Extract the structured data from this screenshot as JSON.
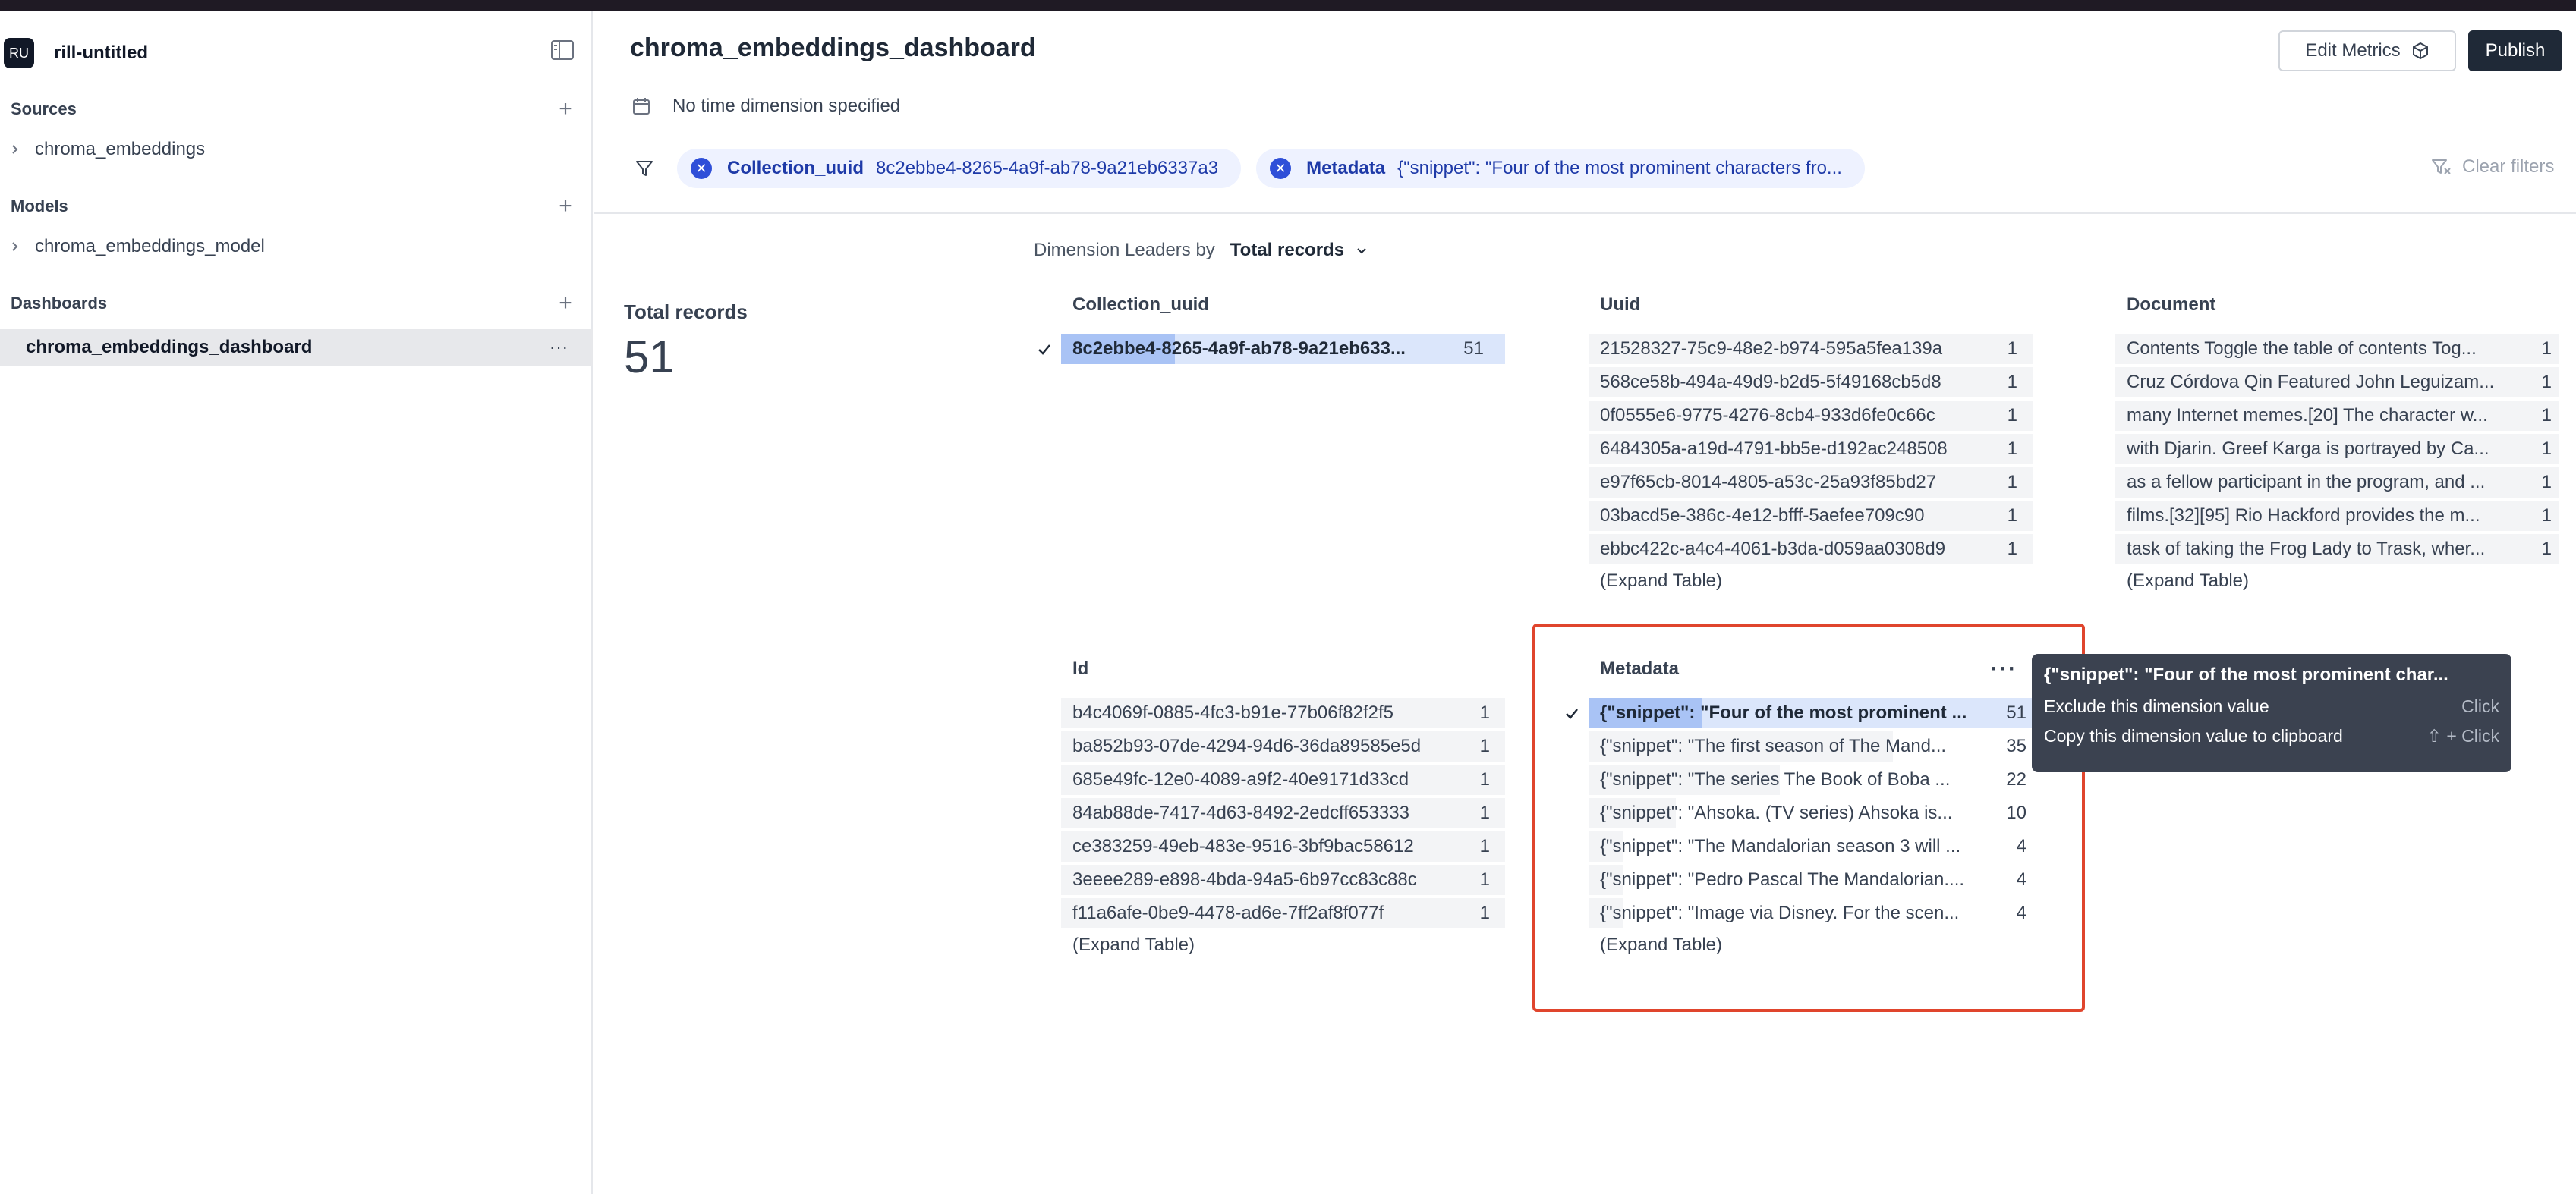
{
  "project": {
    "initials": "RU",
    "name": "rill-untitled"
  },
  "sidebar": {
    "sources": {
      "title": "Sources",
      "items": [
        "chroma_embeddings"
      ]
    },
    "models": {
      "title": "Models",
      "items": [
        "chroma_embeddings_model"
      ]
    },
    "dashboards": {
      "title": "Dashboards",
      "items": [
        "chroma_embeddings_dashboard"
      ]
    }
  },
  "header": {
    "title": "chroma_embeddings_dashboard",
    "edit_metrics": "Edit Metrics",
    "publish": "Publish",
    "time_dimension": "No time dimension specified",
    "clear_filters": "Clear filters",
    "filters": [
      {
        "key": "Collection_uuid",
        "value": "8c2ebbe4-8265-4a9f-ab78-9a21eb6337a3"
      },
      {
        "key": "Metadata",
        "value": "{\"snippet\": \"Four of the most prominent characters fro..."
      }
    ]
  },
  "leaders": {
    "label": "Dimension Leaders by",
    "measure": "Total records"
  },
  "kpi": {
    "label": "Total records",
    "value": "51"
  },
  "expand_label": "(Expand Table)",
  "dimensions": {
    "collection_uuid": {
      "title": "Collection_uuid",
      "rows": [
        {
          "name": "8c2ebbe4-8265-4a9f-ab78-9a21eb633...",
          "count": "51",
          "selected": true
        }
      ]
    },
    "uuid": {
      "title": "Uuid",
      "rows": [
        {
          "name": "21528327-75c9-48e2-b974-595a5fea139a",
          "count": "1"
        },
        {
          "name": "568ce58b-494a-49d9-b2d5-5f49168cb5d8",
          "count": "1"
        },
        {
          "name": "0f0555e6-9775-4276-8cb4-933d6fe0c66c",
          "count": "1"
        },
        {
          "name": "6484305a-a19d-4791-bb5e-d192ac248508",
          "count": "1"
        },
        {
          "name": "e97f65cb-8014-4805-a53c-25a93f85bd27",
          "count": "1"
        },
        {
          "name": "03bacd5e-386c-4e12-bfff-5aefee709c90",
          "count": "1"
        },
        {
          "name": "ebbc422c-a4c4-4061-b3da-d059aa0308d9",
          "count": "1"
        }
      ]
    },
    "document": {
      "title": "Document",
      "rows": [
        {
          "name": "Contents Toggle the table of contents Tog...",
          "count": "1"
        },
        {
          "name": "Cruz Córdova Qin Featured John Leguizam...",
          "count": "1"
        },
        {
          "name": "many Internet memes.[20] The character w...",
          "count": "1"
        },
        {
          "name": "with Djarin. Greef Karga is portrayed by Ca...",
          "count": "1"
        },
        {
          "name": "as a fellow participant in the program, and ...",
          "count": "1"
        },
        {
          "name": "films.[32][95] Rio Hackford provides the m...",
          "count": "1"
        },
        {
          "name": "task of taking the Frog Lady to Trask, wher...",
          "count": "1"
        }
      ]
    },
    "id": {
      "title": "Id",
      "rows": [
        {
          "name": "b4c4069f-0885-4fc3-b91e-77b06f82f2f5",
          "count": "1"
        },
        {
          "name": "ba852b93-07de-4294-94d6-36da89585e5d",
          "count": "1"
        },
        {
          "name": "685e49fc-12e0-4089-a9f2-40e9171d33cd",
          "count": "1"
        },
        {
          "name": "84ab88de-7417-4d63-8492-2edcff653333",
          "count": "1"
        },
        {
          "name": "ce383259-49eb-483e-9516-3bf9bac58612",
          "count": "1"
        },
        {
          "name": "3eeee289-e898-4bda-94a5-6b97cc83c88c",
          "count": "1"
        },
        {
          "name": "f11a6afe-0be9-4478-ad6e-7ff2af8f077f",
          "count": "1"
        }
      ]
    },
    "metadata": {
      "title": "Metadata",
      "rows": [
        {
          "name": "{\"snippet\": \"Four of the most prominent ...",
          "count": "51",
          "selected": true
        },
        {
          "name": "{\"snippet\": \"The first season of The Mand...",
          "count": "35"
        },
        {
          "name": "{\"snippet\": \"The series The Book of Boba ...",
          "count": "22"
        },
        {
          "name": "{\"snippet\": \"Ahsoka. (TV series) Ahsoka is...",
          "count": "10"
        },
        {
          "name": "{\"snippet\": \"The Mandalorian season 3 will ...",
          "count": "4"
        },
        {
          "name": "{\"snippet\": \"Pedro Pascal The Mandalorian....",
          "count": "4"
        },
        {
          "name": "{\"snippet\": \"Image via Disney. For the scen...",
          "count": "4"
        }
      ]
    }
  },
  "tooltip": {
    "title": "{\"snippet\": \"Four of the most prominent char...",
    "rows": [
      {
        "label": "Exclude this dimension value",
        "hint": "Click"
      },
      {
        "label": "Copy this dimension value to clipboard",
        "hint": "⇧ + Click"
      }
    ]
  },
  "colors": {
    "accent": "#2f4fd8",
    "highlight_box": "#e0452d",
    "tooltip_bg": "#3b4250"
  }
}
